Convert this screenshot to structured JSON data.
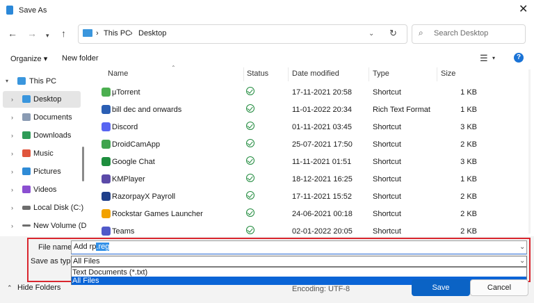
{
  "window": {
    "title": "Save As"
  },
  "address": {
    "crumbs": [
      "This PC",
      "Desktop"
    ],
    "separator": "›"
  },
  "search": {
    "placeholder": "Search Desktop"
  },
  "commands": {
    "organize": "Organize ▾",
    "new_folder": "New folder"
  },
  "sidebar": {
    "items": [
      {
        "label": "This PC",
        "icon": "monitor-icon",
        "color": "#3a96dd"
      },
      {
        "label": "Desktop",
        "icon": "desktop-folder-icon",
        "color": "#3a96dd"
      },
      {
        "label": "Documents",
        "icon": "documents-icon",
        "color": "#8a9bb3"
      },
      {
        "label": "Downloads",
        "icon": "downloads-icon",
        "color": "#2e9b57"
      },
      {
        "label": "Music",
        "icon": "music-icon",
        "color": "#e0553d"
      },
      {
        "label": "Pictures",
        "icon": "pictures-icon",
        "color": "#2f8bd6"
      },
      {
        "label": "Videos",
        "icon": "videos-icon",
        "color": "#8b4fd1"
      },
      {
        "label": "Local Disk (C:)",
        "icon": "drive-icon",
        "color": "#6d6d6d"
      },
      {
        "label": "New Volume (D",
        "icon": "drive-icon",
        "color": "#6d6d6d"
      }
    ]
  },
  "columns": {
    "name": "Name",
    "status": "Status",
    "modified": "Date modified",
    "type": "Type",
    "size": "Size"
  },
  "files": [
    {
      "name": "μTorrent",
      "modified": "17-11-2021 20:58",
      "type": "Shortcut",
      "size": "1 KB",
      "icon_color": "#4caf50"
    },
    {
      "name": "bill dec and onwards",
      "modified": "11-01-2022 20:34",
      "type": "Rich Text Format",
      "size": "1 KB",
      "icon_color": "#2b5fb4"
    },
    {
      "name": "Discord",
      "modified": "01-11-2021 03:45",
      "type": "Shortcut",
      "size": "3 KB",
      "icon_color": "#5865f2"
    },
    {
      "name": "DroidCamApp",
      "modified": "25-07-2021 17:50",
      "type": "Shortcut",
      "size": "2 KB",
      "icon_color": "#3fa34d"
    },
    {
      "name": "Google Chat",
      "modified": "11-11-2021 01:51",
      "type": "Shortcut",
      "size": "3 KB",
      "icon_color": "#1e8e3e"
    },
    {
      "name": "KMPlayer",
      "modified": "18-12-2021 16:25",
      "type": "Shortcut",
      "size": "1 KB",
      "icon_color": "#5b4aa8"
    },
    {
      "name": "RazorpayX Payroll",
      "modified": "17-11-2021 15:52",
      "type": "Shortcut",
      "size": "2 KB",
      "icon_color": "#1f3f8a"
    },
    {
      "name": "Rockstar Games Launcher",
      "modified": "24-06-2021 00:18",
      "type": "Shortcut",
      "size": "2 KB",
      "icon_color": "#f2a200"
    },
    {
      "name": "Teams",
      "modified": "02-01-2022 20:05",
      "type": "Shortcut",
      "size": "2 KB",
      "icon_color": "#5059c9"
    }
  ],
  "form": {
    "file_name_label": "File name:",
    "file_name_value_a": "Add rp",
    "file_name_value_b": ".reg",
    "save_type_label": "Save as type:",
    "save_type_value": "All Files",
    "options": [
      "Text Documents (*.txt)",
      "All Files"
    ]
  },
  "footer": {
    "hide_folders": "Hide Folders",
    "encoding_label": "Encoding:",
    "encoding_value": "UTF-8",
    "save": "Save",
    "cancel": "Cancel"
  },
  "colors": {
    "accent": "#0b63c5",
    "highlight_border": "#d9262e",
    "status_ok": "#1f8a3c"
  }
}
